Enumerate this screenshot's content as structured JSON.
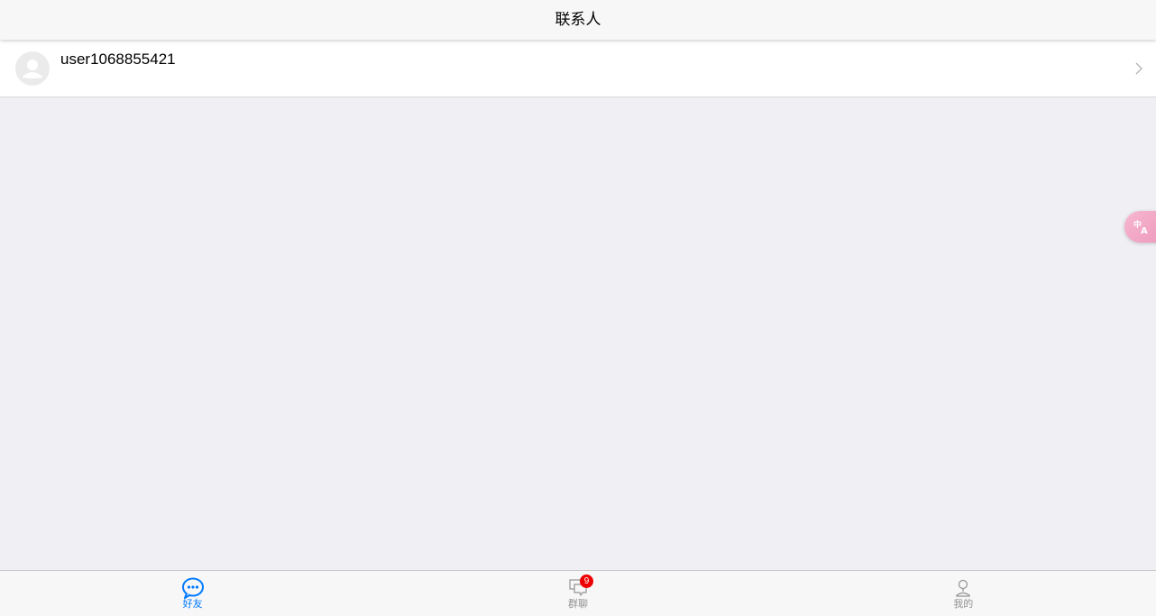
{
  "header": {
    "title": "联系人"
  },
  "contacts": [
    {
      "name": "user1068855421",
      "avatar_icon": "default-avatar-icon",
      "trailing_icon": "chevron-right-icon"
    }
  ],
  "translate_button": {
    "icon": "translate-icon"
  },
  "tabbar": {
    "tabs": [
      {
        "label": "好友",
        "icon": "chat-bubble-icon",
        "active": true
      },
      {
        "label": "群聊",
        "icon": "group-chat-icon",
        "badge": "9"
      },
      {
        "label": "我的",
        "icon": "person-icon"
      }
    ]
  },
  "colors": {
    "accent": "#007aff",
    "badge": "#ee0000",
    "background": "#efeff4",
    "bar": "#f7f7f7",
    "inactive": "#929292"
  }
}
